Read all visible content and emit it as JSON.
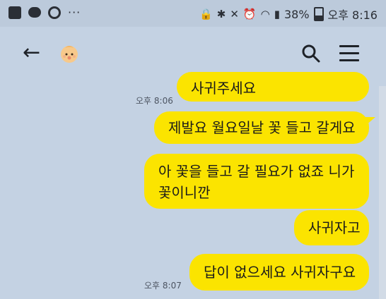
{
  "status_bar": {
    "left_icons": [
      "gallery-icon",
      "talk-icon",
      "record-icon"
    ],
    "overflow": "···",
    "battery": "38%",
    "time": "오후 8:16",
    "right_icons": [
      "lock-icon",
      "bluetooth-icon",
      "mute-icon",
      "alarm-icon",
      "wifi-icon",
      "signal-icon",
      "battery-icon"
    ]
  },
  "header": {
    "back_icon": "arrow-left-icon",
    "avatar_icon": "baby-face-icon",
    "search_icon": "search-icon",
    "menu_icon": "hamburger-menu-icon"
  },
  "messages": [
    {
      "text": "사귀주세요",
      "time": "오후 8:06"
    },
    {
      "text": "제발요 월요일날 꽃 들고 갈게요"
    },
    {
      "text_line1": "아 꽃을 들고 갈 필요가 없죠 니가",
      "text_line2": "꽃이니깐"
    },
    {
      "text": "사귀자고"
    },
    {
      "text": "답이 없으세요 사귀자구요",
      "time": "오후 8:07"
    }
  ],
  "colors": {
    "background": "#c4d2e3",
    "bubble": "#fbe400",
    "text": "#1a1a1a"
  }
}
